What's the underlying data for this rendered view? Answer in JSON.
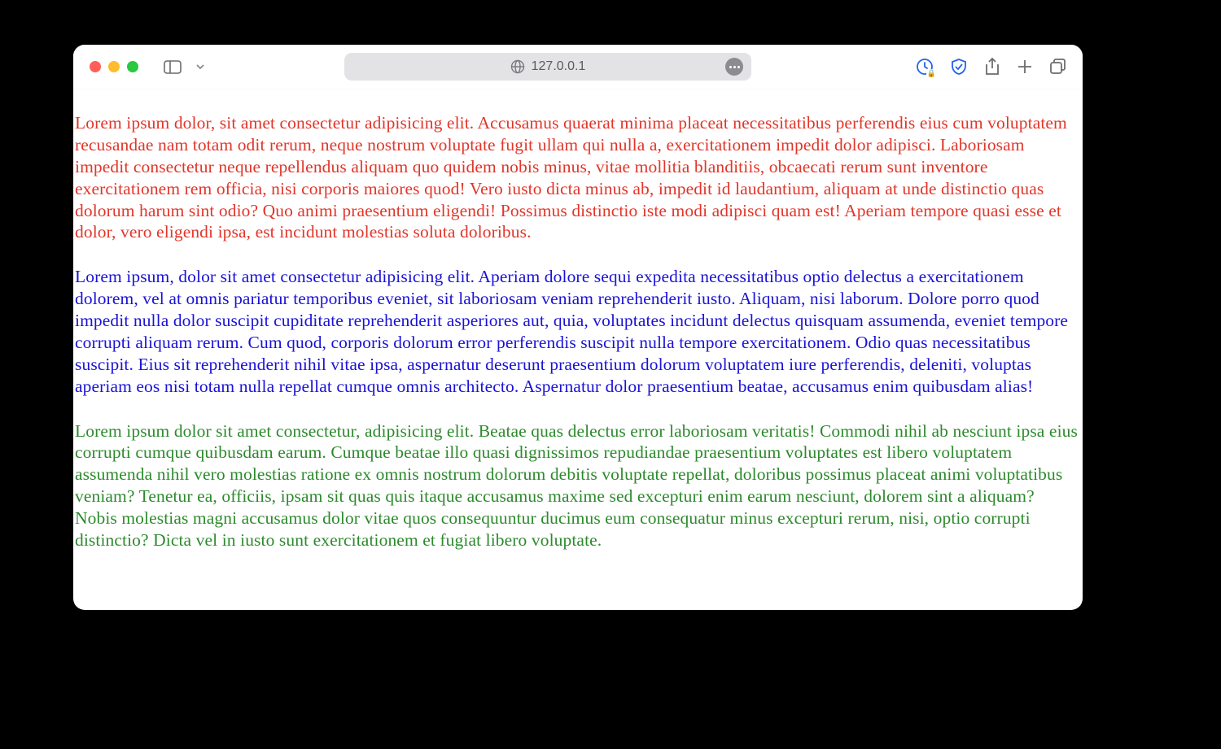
{
  "address": {
    "host": "127.0.0.1"
  },
  "paragraphs": [
    {
      "colorClass": "c-red",
      "text": "Lorem ipsum dolor, sit amet consectetur adipisicing elit. Accusamus quaerat minima placeat necessitatibus perferendis eius cum voluptatem recusandae nam totam odit rerum, neque nostrum voluptate fugit ullam qui nulla a, exercitationem impedit dolor adipisci. Laboriosam impedit consectetur neque repellendus aliquam quo quidem nobis minus, vitae mollitia blanditiis, obcaecati rerum sunt inventore exercitationem rem officia, nisi corporis maiores quod! Vero iusto dicta minus ab, impedit id laudantium, aliquam at unde distinctio quas dolorum harum sint odio? Quo animi praesentium eligendi! Possimus distinctio iste modi adipisci quam est! Aperiam tempore quasi esse et dolor, vero eligendi ipsa, est incidunt molestias soluta doloribus."
    },
    {
      "colorClass": "c-blue",
      "text": "Lorem ipsum, dolor sit amet consectetur adipisicing elit. Aperiam dolore sequi expedita necessitatibus optio delectus a exercitationem dolorem, vel at omnis pariatur temporibus eveniet, sit laboriosam veniam reprehenderit iusto. Aliquam, nisi laborum. Dolore porro quod impedit nulla dolor suscipit cupiditate reprehenderit asperiores aut, quia, voluptates incidunt delectus quisquam assumenda, eveniet tempore corrupti aliquam rerum. Cum quod, corporis dolorum error perferendis suscipit nulla tempore exercitationem. Odio quas necessitatibus suscipit. Eius sit reprehenderit nihil vitae ipsa, aspernatur deserunt praesentium dolorum voluptatem iure perferendis, deleniti, voluptas aperiam eos nisi totam nulla repellat cumque omnis architecto. Aspernatur dolor praesentium beatae, accusamus enim quibusdam alias!"
    },
    {
      "colorClass": "c-green",
      "text": "Lorem ipsum dolor sit amet consectetur, adipisicing elit. Beatae quas delectus error laboriosam veritatis! Commodi nihil ab nesciunt ipsa eius corrupti cumque quibusdam earum. Cumque beatae illo quasi dignissimos repudiandae praesentium voluptates est libero voluptatem assumenda nihil vero molestias ratione ex omnis nostrum dolorum debitis voluptate repellat, doloribus possimus placeat animi voluptatibus veniam? Tenetur ea, officiis, ipsam sit quas quis itaque accusamus maxime sed excepturi enim earum nesciunt, dolorem sint a aliquam? Nobis molestias magni accusamus dolor vitae quos consequuntur ducimus eum consequatur minus excepturi rerum, nisi, optio corrupti distinctio? Dicta vel in iusto sunt exercitationem et fugiat libero voluptate."
    }
  ]
}
